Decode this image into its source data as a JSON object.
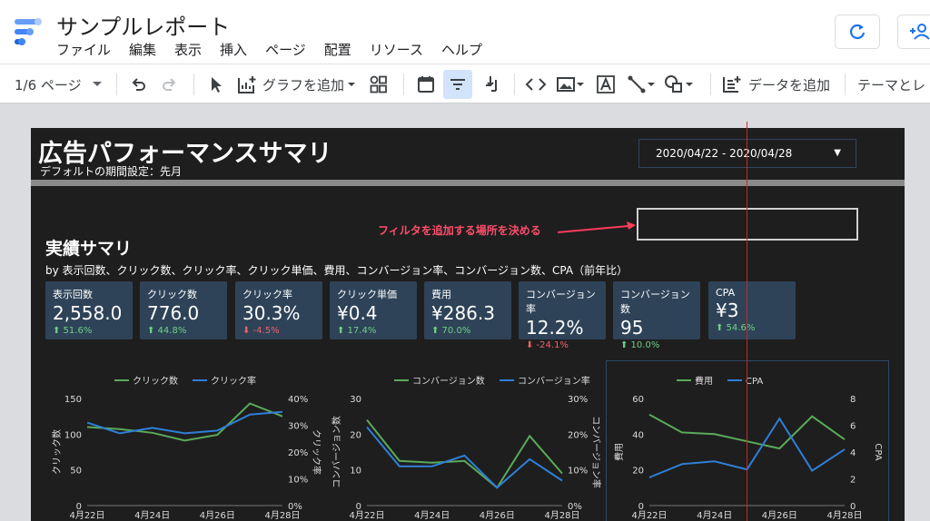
{
  "app": {
    "title": "サンプルレポート",
    "menu": [
      "ファイル",
      "編集",
      "表示",
      "挿入",
      "ページ",
      "配置",
      "リソース",
      "ヘルプ"
    ]
  },
  "toolbar": {
    "page_indicator": "1/6 ページ",
    "add_chart": "グラフを追加",
    "add_data": "データを追加",
    "theme": "テーマとレ"
  },
  "report": {
    "title": "広告パフォーマンスサマリ",
    "subtitle": "デフォルトの期間設定：先月",
    "date_range": "2020/04/22 - 2020/04/28",
    "annotation": "フィルタを追加する場所を決める",
    "section_title": "実績サマリ",
    "section_subtitle": "by 表示回数、クリック数、クリック率、クリック単価、費用、コンバージョン率、コンバージョン数、CPA（前年比）"
  },
  "kpis": [
    {
      "label": "表示回数",
      "value": "2,558.0",
      "change": "51.6%",
      "dir": "up"
    },
    {
      "label": "クリック数",
      "value": "776.0",
      "change": "44.8%",
      "dir": "up"
    },
    {
      "label": "クリック率",
      "value": "30.3%",
      "change": "-4.5%",
      "dir": "down"
    },
    {
      "label": "クリック単価",
      "value": "¥0.4",
      "change": "17.4%",
      "dir": "up"
    },
    {
      "label": "費用",
      "value": "¥286.3",
      "change": "70.0%",
      "dir": "up"
    },
    {
      "label": "コンバージョン率",
      "value": "12.2%",
      "change": "-24.1%",
      "dir": "down"
    },
    {
      "label": "コンバージョン数",
      "value": "95",
      "change": "10.0%",
      "dir": "up"
    },
    {
      "label": "CPA",
      "value": "¥3",
      "change": "54.6%",
      "dir": "up"
    }
  ],
  "colors": {
    "green": "#5aaa5a",
    "blue": "#2f7fd8",
    "up": "#6fcf87",
    "down": "#f0626a"
  },
  "chart_data": [
    {
      "type": "line",
      "x": [
        "4月22日",
        "4月23日",
        "4月24日",
        "4月25日",
        "4月26日",
        "4月27日",
        "4月28日"
      ],
      "x_ticks": [
        "4月22日",
        "4月24日",
        "4月26日",
        "4月28日"
      ],
      "series": [
        {
          "name": "クリック数",
          "axis": "left",
          "values": [
            110,
            107,
            102,
            91,
            99,
            143,
            125
          ]
        },
        {
          "name": "クリック率",
          "axis": "right",
          "values": [
            0.31,
            0.27,
            0.29,
            0.27,
            0.28,
            0.34,
            0.35
          ]
        }
      ],
      "ylabel_left": "クリック数",
      "ylabel_right": "クリック率",
      "ylim_left": [
        0,
        150
      ],
      "ylim_right": [
        0,
        0.4
      ],
      "yticks_left": [
        "0",
        "50",
        "100",
        "150"
      ],
      "yticks_right": [
        "0%",
        "10%",
        "20%",
        "30%",
        "40%"
      ],
      "legend": "top"
    },
    {
      "type": "line",
      "x": [
        "4月22日",
        "4月23日",
        "4月24日",
        "4月25日",
        "4月26日",
        "4月27日",
        "4月28日"
      ],
      "x_ticks": [
        "4月22日",
        "4月24日",
        "4月26日",
        "4月28日"
      ],
      "series": [
        {
          "name": "コンバージョン数",
          "axis": "left",
          "values": [
            24,
            12.5,
            12,
            12.5,
            5,
            19.5,
            9
          ]
        },
        {
          "name": "コンバージョン率",
          "axis": "right",
          "values": [
            0.22,
            0.11,
            0.11,
            0.14,
            0.05,
            0.13,
            0.07
          ]
        }
      ],
      "ylabel_left": "コンバージョン数",
      "ylabel_right": "コンバージョン率",
      "ylim_left": [
        0,
        30
      ],
      "ylim_right": [
        0,
        0.3
      ],
      "yticks_left": [
        "0",
        "10",
        "20",
        "30"
      ],
      "yticks_right": [
        "0%",
        "10%",
        "20%",
        "30%"
      ],
      "legend": "top"
    },
    {
      "type": "line",
      "x": [
        "4月22日",
        "4月23日",
        "4月24日",
        "4月25日",
        "4月26日",
        "4月27日",
        "4月28日"
      ],
      "x_ticks": [
        "4月22日",
        "4月24日",
        "4月26日",
        "4月28日"
      ],
      "series": [
        {
          "name": "費用",
          "axis": "left",
          "values": [
            51,
            41,
            40,
            36,
            32,
            50,
            37
          ]
        },
        {
          "name": "CPA",
          "axis": "right",
          "values": [
            2.1,
            3.1,
            3.3,
            2.7,
            6.5,
            2.6,
            4.2
          ]
        }
      ],
      "ylabel_left": "費用",
      "ylabel_right": "CPA",
      "ylim_left": [
        0,
        60
      ],
      "ylim_right": [
        0,
        8
      ],
      "yticks_left": [
        "0",
        "20",
        "40",
        "60"
      ],
      "yticks_right": [
        "0",
        "2",
        "4",
        "6",
        "8"
      ],
      "legend": "top"
    }
  ]
}
